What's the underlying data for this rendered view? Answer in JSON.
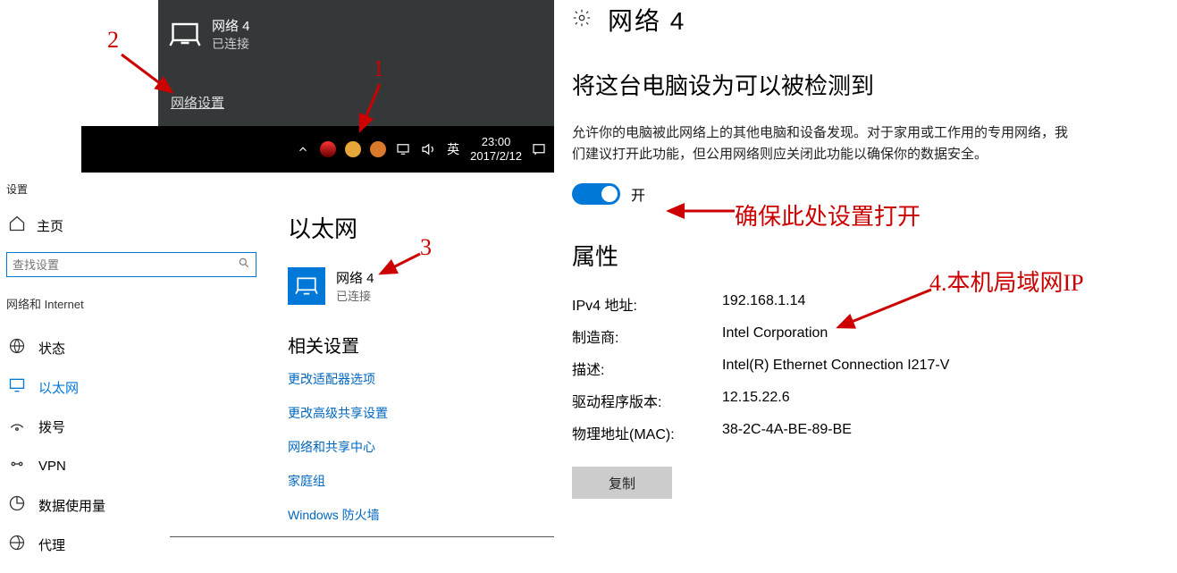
{
  "flyout": {
    "network_name": "网络 4",
    "status": "已连接",
    "link": "网络设置"
  },
  "taskbar": {
    "ime": "英",
    "time": "23:00",
    "date": "2017/2/12"
  },
  "settings_title": "设置",
  "left": {
    "home": "主页",
    "search_placeholder": "查找设置",
    "category": "网络和 Internet",
    "nav": {
      "status": "状态",
      "ethernet": "以太网",
      "dialup": "拨号",
      "vpn": "VPN",
      "data_usage": "数据使用量",
      "proxy": "代理"
    }
  },
  "mid": {
    "heading": "以太网",
    "network_name": "网络 4",
    "network_status": "已连接",
    "related_heading": "相关设置",
    "links": {
      "adapter": "更改适配器选项",
      "sharing": "更改高级共享设置",
      "center": "网络和共享中心",
      "homegroup": "家庭组",
      "firewall": "Windows 防火墙"
    }
  },
  "right": {
    "title": "网络 4",
    "discover_heading": "将这台电脑设为可以被检测到",
    "discover_desc": "允许你的电脑被此网络上的其他电脑和设备发现。对于家用或工作用的专用网络，我们建议打开此功能，但公用网络则应关闭此功能以确保你的数据安全。",
    "toggle_label": "开",
    "props_heading": "属性",
    "props": {
      "ipv4_label": "IPv4 地址:",
      "ipv4_val": "192.168.1.14",
      "vendor_label": "制造商:",
      "vendor_val": "Intel Corporation",
      "desc_label": "描述:",
      "desc_val": "Intel(R) Ethernet Connection I217-V",
      "driver_label": "驱动程序版本:",
      "driver_val": "12.15.22.6",
      "mac_label": "物理地址(MAC):",
      "mac_val": "38-2C-4A-BE-89-BE"
    },
    "copy_btn": "复制"
  },
  "annotations": {
    "a1": "1",
    "a2": "2",
    "a3": "3",
    "hint_toggle": "确保此处设置打开",
    "hint_ip": "4.本机局域网IP"
  }
}
